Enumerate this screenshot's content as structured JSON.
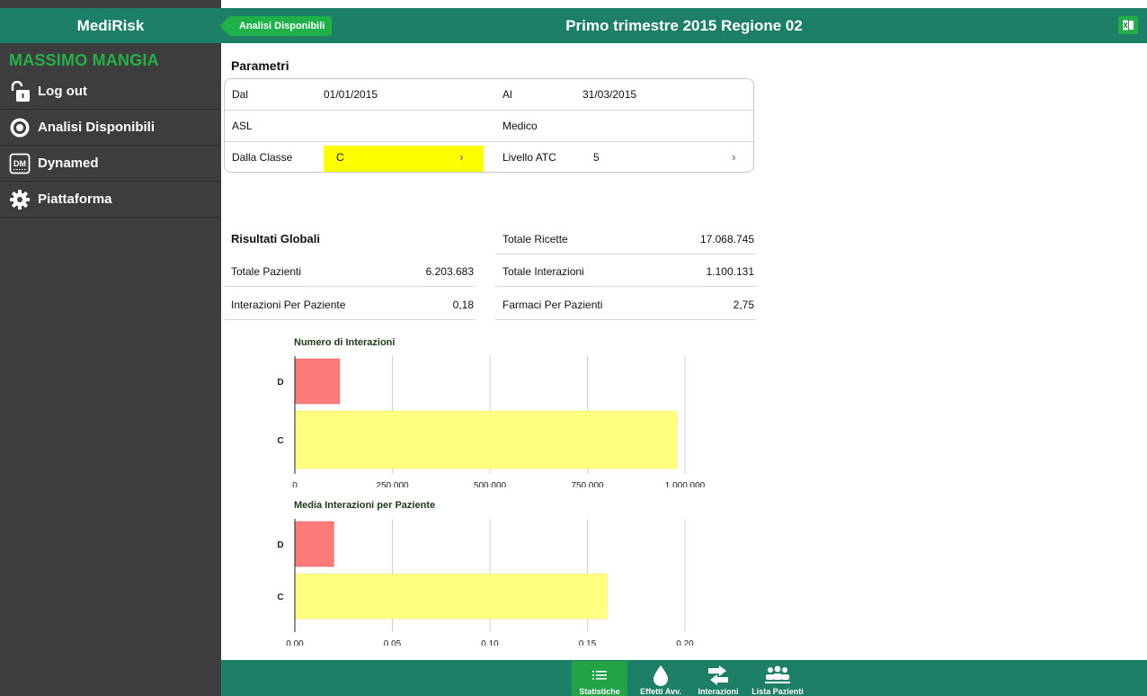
{
  "sidebar": {
    "app_name": "MediRisk",
    "user_name": "MASSIMO MANGIA",
    "items": [
      {
        "label": "Log out",
        "icon": "unlock-icon"
      },
      {
        "label": "Analisi Disponibili",
        "icon": "target-icon"
      },
      {
        "label": "Dynamed",
        "icon": "dynamed-icon"
      },
      {
        "label": "Piattaforma",
        "icon": "gear-icon"
      }
    ]
  },
  "header": {
    "back_label": "Analisi Disponibili",
    "title": "Primo trimestre 2015 Regione 02",
    "export_icon": "excel-icon"
  },
  "params": {
    "title": "Parametri",
    "dal_label": "Dal",
    "dal_value": "01/01/2015",
    "al_label": "Al",
    "al_value": "31/03/2015",
    "asl_label": "ASL",
    "medico_label": "Medico",
    "classe_label": "Dalla Classe",
    "classe_value": "C",
    "atc_label": "Livello ATC",
    "atc_value": "5"
  },
  "globals": {
    "title": "Risultati Globali",
    "left": [
      {
        "label": "Totale Pazienti",
        "value": "6.203.683"
      },
      {
        "label": "Interazioni Per Paziente",
        "value": "0,18"
      }
    ],
    "right": [
      {
        "label": "Totale Ricette",
        "value": "17.068.745"
      },
      {
        "label": "Totale Interazioni",
        "value": "1.100.131"
      },
      {
        "label": "Farmaci Per Pazienti",
        "value": "2,75"
      }
    ]
  },
  "chart_data": [
    {
      "type": "bar",
      "orientation": "horizontal",
      "title": "Numero di Interazioni",
      "categories": [
        "D",
        "C"
      ],
      "values": [
        115000,
        980000
      ],
      "colors": [
        "#ff7a7a",
        "#ffff80"
      ],
      "xlim": [
        0,
        1000000
      ],
      "ticks": [
        "0",
        "250.000",
        "500.000",
        "750.000",
        "1.000.000"
      ],
      "grid": true
    },
    {
      "type": "bar",
      "orientation": "horizontal",
      "title": "Media Interazioni per Paziente",
      "categories": [
        "D",
        "C"
      ],
      "values": [
        0.02,
        0.16
      ],
      "colors": [
        "#ff7a7a",
        "#ffff80"
      ],
      "xlim": [
        0,
        0.2
      ],
      "ticks": [
        "0,00",
        "0,05",
        "0,10",
        "0,15",
        "0,20"
      ],
      "grid": true
    }
  ],
  "tabs": [
    {
      "label": "Statistiche",
      "icon": "list-icon",
      "active": true
    },
    {
      "label": "Effetti Avv.",
      "icon": "drop-icon",
      "active": false
    },
    {
      "label": "Interazioni",
      "icon": "arrows-icon",
      "active": false
    },
    {
      "label": "Lista Pazienti",
      "icon": "people-icon",
      "active": false
    }
  ],
  "colors": {
    "brand_green": "#1e7f67",
    "accent_green": "#1fb04a",
    "sidebar_bg": "#3d3d3d",
    "selection_yellow": "#ffff00"
  }
}
